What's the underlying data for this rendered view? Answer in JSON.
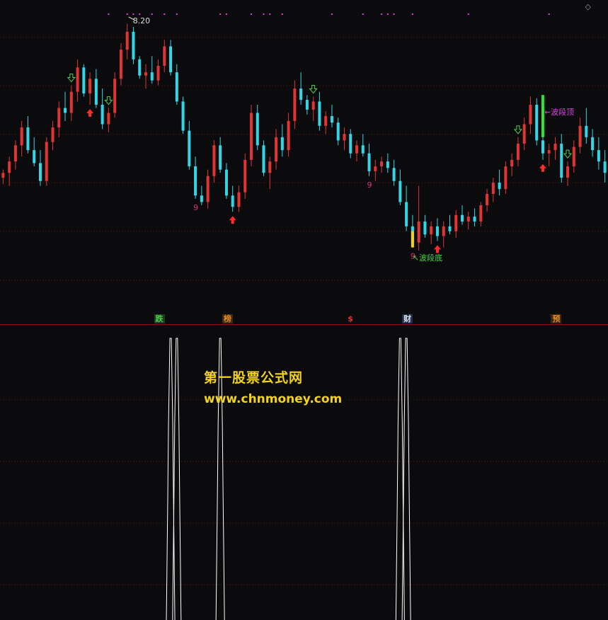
{
  "chart_data": [
    {
      "type": "candlestick",
      "panel": "price",
      "grid": true,
      "up_color": "#e03535",
      "down_color": "#34d6e6",
      "ylim": [
        6.7,
        8.35
      ],
      "candles": [
        [
          7.35,
          7.4,
          7.31,
          7.38
        ],
        [
          7.38,
          7.48,
          7.3,
          7.45
        ],
        [
          7.45,
          7.58,
          7.4,
          7.55
        ],
        [
          7.55,
          7.7,
          7.48,
          7.66
        ],
        [
          7.66,
          7.73,
          7.5,
          7.52
        ],
        [
          7.52,
          7.6,
          7.42,
          7.44
        ],
        [
          7.44,
          7.52,
          7.3,
          7.33
        ],
        [
          7.33,
          7.6,
          7.3,
          7.57
        ],
        [
          7.57,
          7.7,
          7.52,
          7.66
        ],
        [
          7.66,
          7.82,
          7.6,
          7.78
        ],
        [
          7.78,
          7.88,
          7.7,
          7.75
        ],
        [
          7.75,
          7.92,
          7.7,
          7.88
        ],
        [
          7.88,
          8.08,
          7.82,
          8.03
        ],
        [
          8.03,
          8.05,
          7.85,
          7.87
        ],
        [
          7.87,
          8.0,
          7.8,
          7.96
        ],
        [
          7.96,
          8.02,
          7.78,
          7.8
        ],
        [
          7.8,
          7.9,
          7.65,
          7.68
        ],
        [
          7.68,
          7.78,
          7.63,
          7.75
        ],
        [
          7.75,
          8.0,
          7.72,
          7.96
        ],
        [
          7.96,
          8.18,
          7.92,
          8.14
        ],
        [
          8.14,
          8.3,
          8.08,
          8.25
        ],
        [
          8.25,
          8.28,
          8.05,
          8.08
        ],
        [
          8.08,
          8.1,
          7.96,
          7.98
        ],
        [
          7.98,
          8.05,
          7.9,
          8.0
        ],
        [
          8.0,
          8.1,
          7.93,
          7.95
        ],
        [
          7.95,
          8.08,
          7.92,
          8.04
        ],
        [
          8.04,
          8.2,
          8.0,
          8.16
        ],
        [
          8.16,
          8.2,
          7.98,
          8.0
        ],
        [
          8.0,
          8.05,
          7.8,
          7.82
        ],
        [
          7.82,
          7.85,
          7.62,
          7.64
        ],
        [
          7.64,
          7.7,
          7.4,
          7.42
        ],
        [
          7.42,
          7.48,
          7.22,
          7.24
        ],
        [
          7.24,
          7.3,
          7.18,
          7.2
        ],
        [
          7.2,
          7.4,
          7.16,
          7.36
        ],
        [
          7.36,
          7.58,
          7.32,
          7.55
        ],
        [
          7.55,
          7.6,
          7.38,
          7.4
        ],
        [
          7.4,
          7.44,
          7.22,
          7.24
        ],
        [
          7.24,
          7.3,
          7.14,
          7.17
        ],
        [
          7.17,
          7.3,
          7.14,
          7.26
        ],
        [
          7.26,
          7.5,
          7.22,
          7.46
        ],
        [
          7.46,
          7.8,
          7.42,
          7.75
        ],
        [
          7.75,
          7.8,
          7.52,
          7.55
        ],
        [
          7.55,
          7.58,
          7.36,
          7.38
        ],
        [
          7.38,
          7.48,
          7.28,
          7.45
        ],
        [
          7.45,
          7.65,
          7.4,
          7.6
        ],
        [
          7.6,
          7.68,
          7.48,
          7.52
        ],
        [
          7.52,
          7.75,
          7.48,
          7.7
        ],
        [
          7.7,
          7.95,
          7.65,
          7.9
        ],
        [
          7.9,
          8.0,
          7.8,
          7.83
        ],
        [
          7.83,
          7.86,
          7.74,
          7.77
        ],
        [
          7.77,
          7.85,
          7.7,
          7.82
        ],
        [
          7.82,
          7.88,
          7.64,
          7.67
        ],
        [
          7.67,
          7.76,
          7.62,
          7.73
        ],
        [
          7.73,
          7.8,
          7.66,
          7.69
        ],
        [
          7.69,
          7.72,
          7.55,
          7.58
        ],
        [
          7.58,
          7.66,
          7.52,
          7.62
        ],
        [
          7.62,
          7.65,
          7.47,
          7.5
        ],
        [
          7.5,
          7.58,
          7.45,
          7.55
        ],
        [
          7.55,
          7.62,
          7.48,
          7.5
        ],
        [
          7.5,
          7.56,
          7.36,
          7.39
        ],
        [
          7.39,
          7.46,
          7.33,
          7.42
        ],
        [
          7.42,
          7.48,
          7.38,
          7.45
        ],
        [
          7.45,
          7.5,
          7.38,
          7.41
        ],
        [
          7.41,
          7.46,
          7.3,
          7.33
        ],
        [
          7.33,
          7.4,
          7.18,
          7.2
        ],
        [
          7.2,
          7.3,
          7.02,
          7.05
        ],
        [
          7.05,
          7.12,
          6.92,
          6.95
        ],
        [
          6.95,
          7.3,
          6.9,
          7.08
        ],
        [
          7.08,
          7.12,
          6.98,
          7.0
        ],
        [
          7.0,
          7.08,
          6.94,
          7.05
        ],
        [
          7.05,
          7.1,
          6.96,
          6.99
        ],
        [
          6.99,
          7.08,
          6.92,
          7.05
        ],
        [
          7.05,
          7.12,
          7.0,
          7.02
        ],
        [
          7.02,
          7.15,
          6.98,
          7.12
        ],
        [
          7.12,
          7.18,
          7.06,
          7.08
        ],
        [
          7.08,
          7.14,
          7.03,
          7.11
        ],
        [
          7.11,
          7.16,
          7.05,
          7.08
        ],
        [
          7.08,
          7.2,
          7.05,
          7.18
        ],
        [
          7.18,
          7.28,
          7.14,
          7.25
        ],
        [
          7.25,
          7.35,
          7.2,
          7.32
        ],
        [
          7.32,
          7.4,
          7.24,
          7.28
        ],
        [
          7.28,
          7.45,
          7.25,
          7.42
        ],
        [
          7.42,
          7.5,
          7.36,
          7.46
        ],
        [
          7.46,
          7.6,
          7.42,
          7.56
        ],
        [
          7.56,
          7.72,
          7.52,
          7.68
        ],
        [
          7.68,
          7.85,
          7.62,
          7.8
        ],
        [
          7.8,
          7.84,
          7.55,
          7.58
        ],
        [
          7.58,
          7.62,
          7.46,
          7.5
        ],
        [
          7.5,
          7.56,
          7.42,
          7.52
        ],
        [
          7.52,
          7.6,
          7.46,
          7.56
        ],
        [
          7.56,
          7.62,
          7.32,
          7.35
        ],
        [
          7.35,
          7.45,
          7.3,
          7.42
        ],
        [
          7.42,
          7.58,
          7.38,
          7.54
        ],
        [
          7.54,
          7.72,
          7.5,
          7.67
        ],
        [
          7.67,
          7.78,
          7.56,
          7.6
        ],
        [
          7.6,
          7.65,
          7.48,
          7.52
        ],
        [
          7.52,
          7.6,
          7.4,
          7.45
        ],
        [
          7.45,
          7.52,
          7.32,
          7.38
        ]
      ],
      "annotations": [
        {
          "candle": 20,
          "price": 8.2,
          "text": "8.20",
          "color": "#dddddd"
        },
        {
          "candle": 87,
          "price": 7.9,
          "text": "←波段顶",
          "color": "#e040e0"
        },
        {
          "candle": 66,
          "price": 6.85,
          "text": "↖波段底",
          "color": "#4ad04a"
        }
      ],
      "count_labels": [
        {
          "candle": 31,
          "text": "9"
        },
        {
          "candle": 59,
          "text": "9"
        },
        {
          "candle": 66,
          "text": "9"
        }
      ],
      "up_arrows": [
        14,
        37,
        70,
        87
      ],
      "down_arrows": [
        11,
        17,
        50,
        83,
        91
      ],
      "top_dots": [
        17,
        20,
        21,
        22,
        24,
        26,
        28,
        35,
        36,
        40,
        42,
        43,
        45,
        53,
        58,
        61,
        62,
        63,
        66,
        75,
        88
      ],
      "bottom_badges": [
        {
          "text": "跌",
          "color": "#4ad04a",
          "bg": "#203a20",
          "candle": 25
        },
        {
          "text": "榜",
          "color": "#e08a20",
          "bg": "#3a2a12",
          "candle": 36
        },
        {
          "text": "$",
          "color": "#e03030",
          "bg": "transparent",
          "candle": 56
        },
        {
          "text": "财",
          "color": "#dddddd",
          "bg": "#1e2e4e",
          "candle": 65
        },
        {
          "text": "预",
          "color": "#e08a20",
          "bg": "#3a2412",
          "candle": 89
        }
      ]
    },
    {
      "type": "line",
      "panel": "indicator",
      "color": "#ffffff",
      "spikes": [
        27,
        28,
        35,
        64,
        65
      ]
    }
  ],
  "watermark": {
    "title": "第一股票公式网",
    "url": "www.chnmoney.com"
  },
  "corner_icon": "◇"
}
